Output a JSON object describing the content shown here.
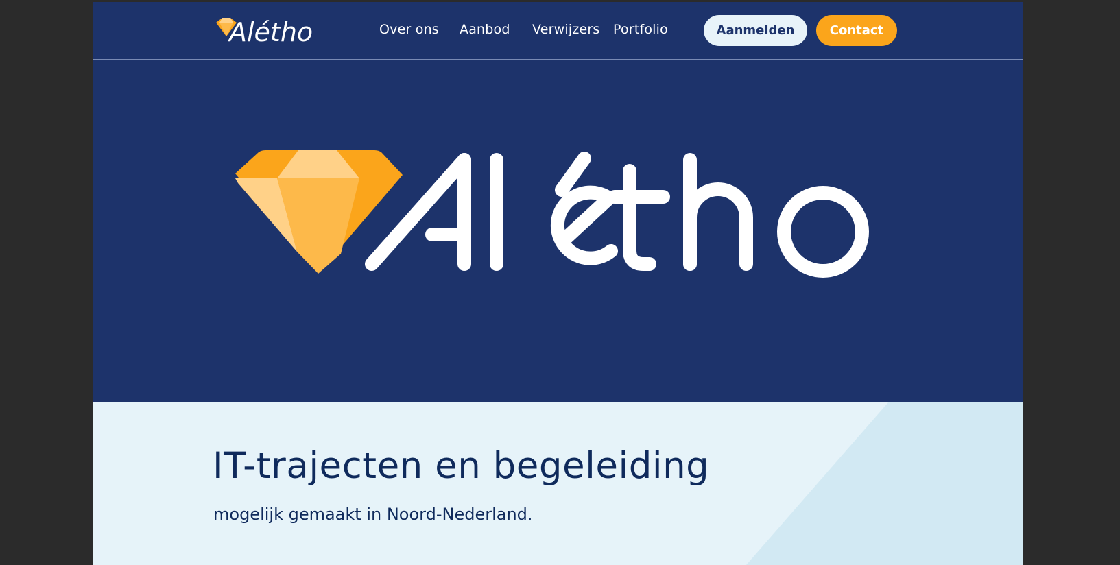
{
  "brand": {
    "name": "Alétho",
    "colors": {
      "navy": "#1d336b",
      "orange": "#fba51b",
      "light_blue": "#e6f3f9",
      "white": "#ffffff"
    },
    "logo_icon": "diamond-icon"
  },
  "nav": {
    "links": [
      "Over ons",
      "Aanbod",
      "Verwijzers",
      "Portfolio"
    ],
    "login_label": "Aanmelden",
    "contact_label": "Contact"
  },
  "intro": {
    "title": "IT-trajecten en begeleiding",
    "subtitle": "mogelijk gemaakt in Noord-Nederland."
  }
}
